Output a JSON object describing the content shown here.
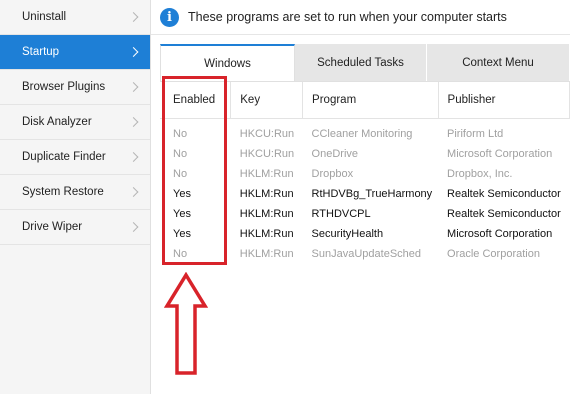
{
  "sidebar": {
    "items": [
      {
        "label": "Uninstall",
        "active": false
      },
      {
        "label": "Startup",
        "active": true
      },
      {
        "label": "Browser Plugins",
        "active": false
      },
      {
        "label": "Disk Analyzer",
        "active": false
      },
      {
        "label": "Duplicate Finder",
        "active": false
      },
      {
        "label": "System Restore",
        "active": false
      },
      {
        "label": "Drive Wiper",
        "active": false
      }
    ]
  },
  "info": {
    "icon": "i",
    "text": "These programs are set to run when your computer starts"
  },
  "tabs": [
    {
      "label": "Windows",
      "active": true
    },
    {
      "label": "Scheduled Tasks",
      "active": false
    },
    {
      "label": "Context Menu",
      "active": false
    }
  ],
  "table": {
    "headers": [
      "Enabled",
      "Key",
      "Program",
      "Publisher"
    ],
    "rows": [
      {
        "enabled": "No",
        "key": "HKCU:Run",
        "program": "CCleaner Monitoring",
        "publisher": "Piriform Ltd"
      },
      {
        "enabled": "No",
        "key": "HKCU:Run",
        "program": "OneDrive",
        "publisher": "Microsoft Corporation"
      },
      {
        "enabled": "No",
        "key": "HKLM:Run",
        "program": "Dropbox",
        "publisher": "Dropbox, Inc."
      },
      {
        "enabled": "Yes",
        "key": "HKLM:Run",
        "program": "RtHDVBg_TrueHarmony",
        "publisher": "Realtek Semiconductor"
      },
      {
        "enabled": "Yes",
        "key": "HKLM:Run",
        "program": "RTHDVCPL",
        "publisher": "Realtek Semiconductor"
      },
      {
        "enabled": "Yes",
        "key": "HKLM:Run",
        "program": "SecurityHealth",
        "publisher": "Microsoft Corporation"
      },
      {
        "enabled": "No",
        "key": "HKLM:Run",
        "program": "SunJavaUpdateSched",
        "publisher": "Oracle Corporation"
      }
    ]
  },
  "colors": {
    "accent": "#1e7fd6",
    "annotation": "#d8232a",
    "disabled_text": "#a0a0a0"
  }
}
